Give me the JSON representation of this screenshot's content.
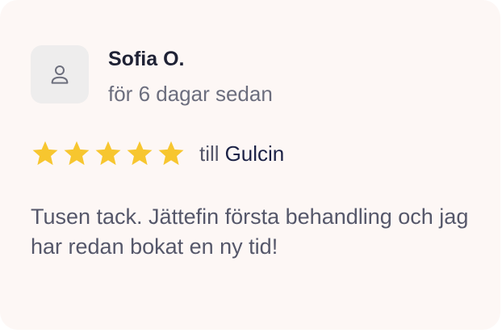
{
  "review": {
    "reviewer_name": "Sofia O.",
    "date": "för 6 dagar sedan",
    "avatar_icon": "user-icon",
    "rating": 5,
    "rating_max": 5,
    "star_icon": "star-icon",
    "star_color": "#f7c62f",
    "recipient_prefix": "till",
    "recipient_name": "Gulcin",
    "text": "Tusen tack. Jättefin första behandling och jag har redan bokat en ny tid!"
  },
  "colors": {
    "card_background": "#fdf7f5",
    "avatar_background": "#eeeded",
    "name_text": "#1f2235",
    "muted_text": "#6c6e7e",
    "recipient_text": "#1c2246"
  }
}
